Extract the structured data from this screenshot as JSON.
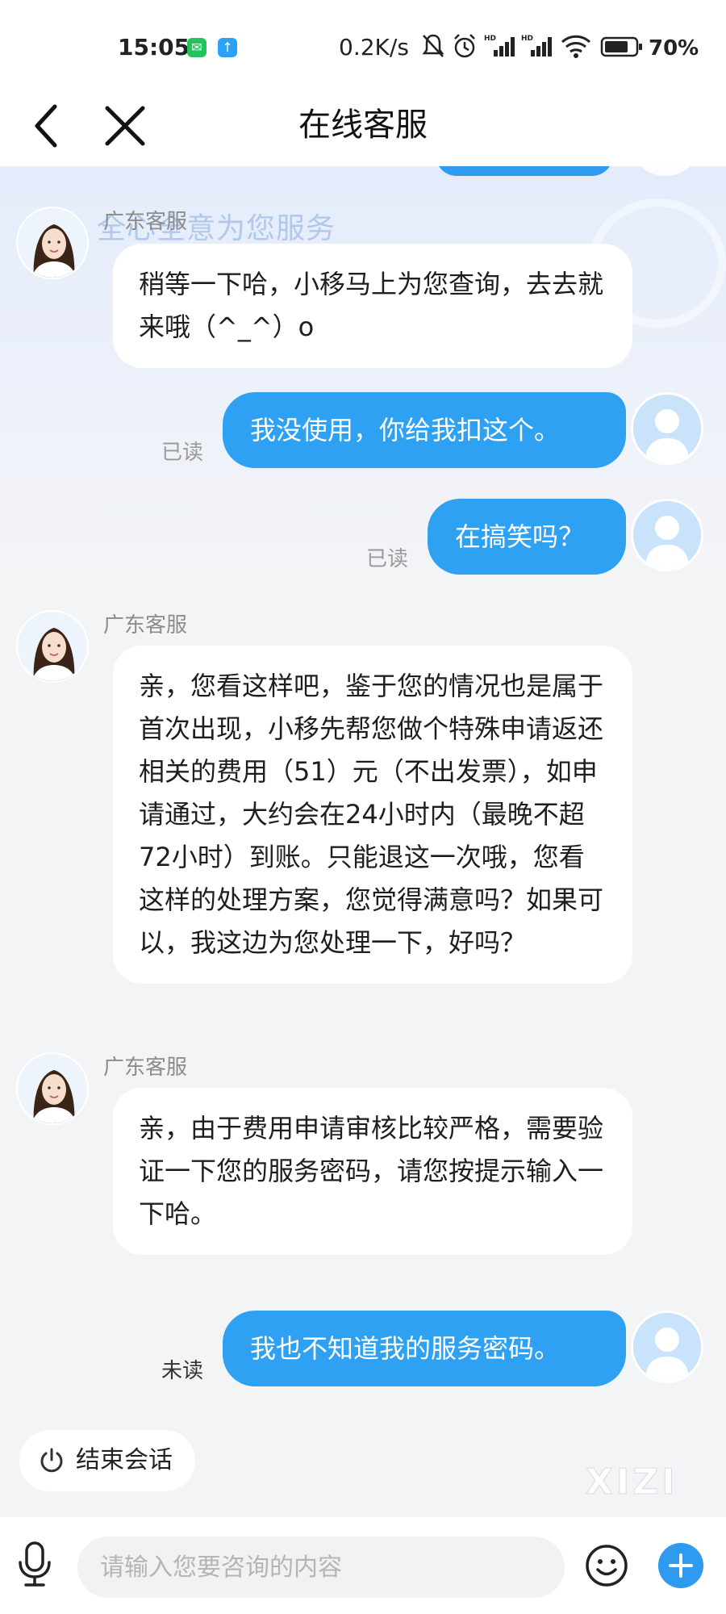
{
  "status_bar": {
    "time": "15:05",
    "speed": "0.2K/s",
    "battery": "70%",
    "icons": [
      "wechat-icon",
      "upload-icon",
      "mute-icon",
      "alarm-icon",
      "hd-signal-icon",
      "hd-signal-icon",
      "wifi-icon",
      "battery-icon"
    ]
  },
  "nav": {
    "title": "在线客服",
    "back_icon": "chevron-left-icon",
    "close_icon": "close-icon"
  },
  "banner": {
    "text": "全心全意为您服务"
  },
  "messages": [
    {
      "from": "agent",
      "sender": "广东客服",
      "text": "稍等一下哈，小移马上为您查询，去去就来哦（^_^）o"
    },
    {
      "from": "user",
      "text": "我没使用，你给我扣这个。",
      "status": "已读"
    },
    {
      "from": "user",
      "text": "在搞笑吗？",
      "status": "已读"
    },
    {
      "from": "agent",
      "sender": "广东客服",
      "text": "亲，您看这样吧，鉴于您的情况也是属于首次出现，小移先帮您做个特殊申请返还相关的费用（51）元（不出发票），如申请通过，大约会在24小时内（最晚不超72小时）到账。只能退这一次哦，您看这样的处理方案，您觉得满意吗？如果可以，我这边为您处理一下，好吗？"
    },
    {
      "from": "agent",
      "sender": "广东客服",
      "text": "亲，由于费用申请审核比较严格，需要验证一下您的服务密码，请您按提示输入一下哈。"
    },
    {
      "from": "user",
      "text": "我也不知道我的服务密码。",
      "status": "未读"
    }
  ],
  "actions": {
    "end_session": "结束会话"
  },
  "watermark": "XIZI",
  "input": {
    "placeholder": "请输入您要咨询的内容",
    "value": ""
  },
  "colors": {
    "user_bubble": "#2fa1f3",
    "accent": "#2f9bf0",
    "agent_bubble": "#ffffff"
  }
}
